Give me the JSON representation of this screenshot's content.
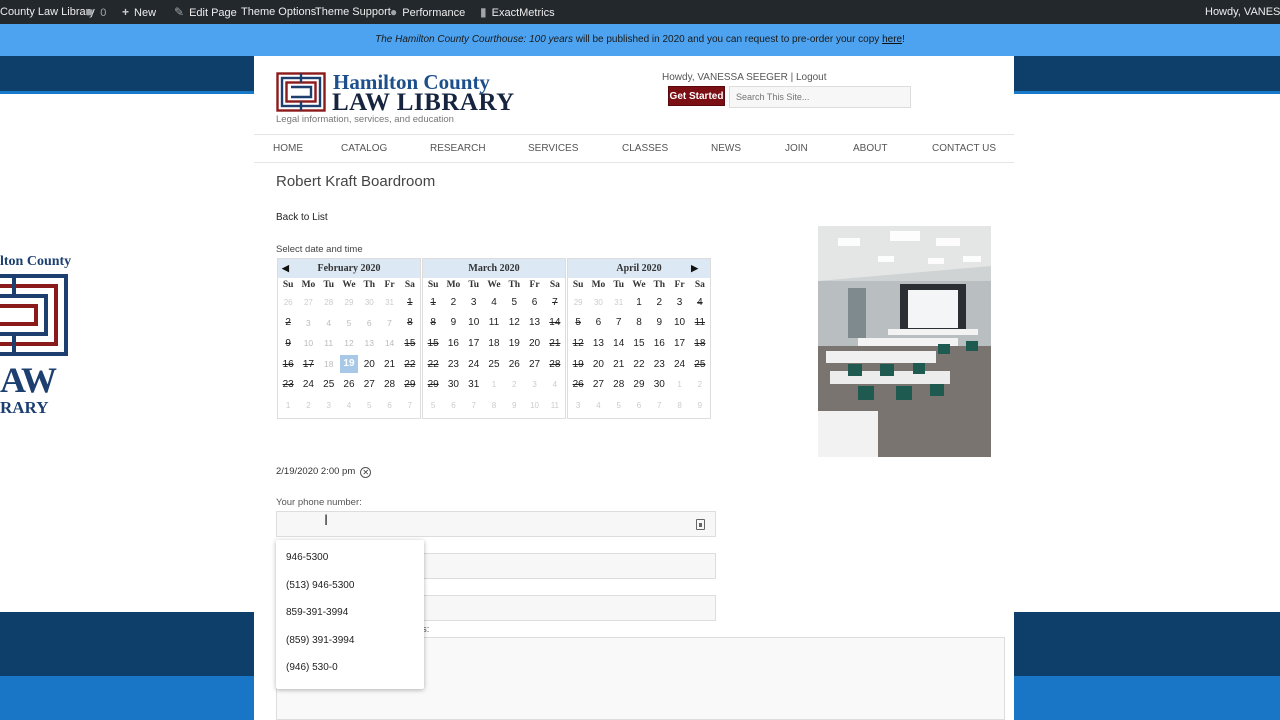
{
  "adminbar": {
    "site": "County Law Library",
    "comments_count": "0",
    "new": "New",
    "edit_page": "Edit Page",
    "theme_options": "Theme Options",
    "theme_support": "Theme Support",
    "performance": "Performance",
    "exactmetrics": "ExactMetrics",
    "howdy": "Howdy, VANESSA"
  },
  "announce": {
    "italic": "The Hamilton County Courthouse: 100 years",
    "text": " will be published in 2020 and you can request to pre-order your copy ",
    "link": "here",
    "tail": "!"
  },
  "bg_logo": {
    "line1": "lton County",
    "line2": "AW",
    "line3": "RARY"
  },
  "header": {
    "logo_name1": "Hamilton County",
    "logo_name2": "LAW LIBRARY",
    "logo_tagline": "Legal information, services, and education",
    "howdy": "Howdy, VANESSA SEEGER | Logout",
    "get_started": "Get Started",
    "search_placeholder": "Search This Site..."
  },
  "nav": [
    "HOME",
    "CATALOG",
    "RESEARCH",
    "SERVICES",
    "CLASSES",
    "NEWS",
    "JOIN",
    "ABOUT",
    "CONTACT US"
  ],
  "main": {
    "title": "Robert Kraft Boardroom",
    "back": "Back to List",
    "select_label": "Select date and time",
    "chosen_datetime": "2/19/2020 2:00 pm",
    "phone_label": "Your phone number:",
    "field4_label_fragment": "s:"
  },
  "calendar": {
    "weekdays": [
      "Su",
      "Mo",
      "Tu",
      "We",
      "Th",
      "Fr",
      "Sa"
    ],
    "prev_icon": "triangle-left-icon",
    "next_icon": "triangle-right-icon",
    "months": [
      {
        "title": "February 2020",
        "weeks": [
          [
            {
              "d": "26",
              "c": "other"
            },
            {
              "d": "27",
              "c": "other"
            },
            {
              "d": "28",
              "c": "other"
            },
            {
              "d": "29",
              "c": "other"
            },
            {
              "d": "30",
              "c": "other"
            },
            {
              "d": "31",
              "c": "other"
            },
            {
              "d": "1",
              "c": "strike"
            }
          ],
          [
            {
              "d": "2",
              "c": "strike"
            },
            {
              "d": "3",
              "c": "dim"
            },
            {
              "d": "4",
              "c": "dim"
            },
            {
              "d": "5",
              "c": "dim"
            },
            {
              "d": "6",
              "c": "dim"
            },
            {
              "d": "7",
              "c": "dim"
            },
            {
              "d": "8",
              "c": "strike"
            }
          ],
          [
            {
              "d": "9",
              "c": "strike"
            },
            {
              "d": "10",
              "c": "dim"
            },
            {
              "d": "11",
              "c": "dim"
            },
            {
              "d": "12",
              "c": "dim"
            },
            {
              "d": "13",
              "c": "dim"
            },
            {
              "d": "14",
              "c": "dim"
            },
            {
              "d": "15",
              "c": "strike"
            }
          ],
          [
            {
              "d": "16",
              "c": "strike"
            },
            {
              "d": "17",
              "c": "strike"
            },
            {
              "d": "18",
              "c": "dim"
            },
            {
              "d": "19",
              "c": "sel"
            },
            {
              "d": "20",
              "c": ""
            },
            {
              "d": "21",
              "c": ""
            },
            {
              "d": "22",
              "c": "strike"
            }
          ],
          [
            {
              "d": "23",
              "c": "strike"
            },
            {
              "d": "24",
              "c": ""
            },
            {
              "d": "25",
              "c": ""
            },
            {
              "d": "26",
              "c": ""
            },
            {
              "d": "27",
              "c": ""
            },
            {
              "d": "28",
              "c": ""
            },
            {
              "d": "29",
              "c": "strike"
            }
          ],
          [
            {
              "d": "1",
              "c": "other"
            },
            {
              "d": "2",
              "c": "other"
            },
            {
              "d": "3",
              "c": "other"
            },
            {
              "d": "4",
              "c": "other"
            },
            {
              "d": "5",
              "c": "other"
            },
            {
              "d": "6",
              "c": "other"
            },
            {
              "d": "7",
              "c": "other"
            }
          ]
        ]
      },
      {
        "title": "March 2020",
        "weeks": [
          [
            {
              "d": "1",
              "c": "strike"
            },
            {
              "d": "2",
              "c": ""
            },
            {
              "d": "3",
              "c": ""
            },
            {
              "d": "4",
              "c": ""
            },
            {
              "d": "5",
              "c": ""
            },
            {
              "d": "6",
              "c": ""
            },
            {
              "d": "7",
              "c": "strike"
            }
          ],
          [
            {
              "d": "8",
              "c": "strike"
            },
            {
              "d": "9",
              "c": ""
            },
            {
              "d": "10",
              "c": ""
            },
            {
              "d": "11",
              "c": ""
            },
            {
              "d": "12",
              "c": ""
            },
            {
              "d": "13",
              "c": ""
            },
            {
              "d": "14",
              "c": "strike"
            }
          ],
          [
            {
              "d": "15",
              "c": "strike"
            },
            {
              "d": "16",
              "c": ""
            },
            {
              "d": "17",
              "c": ""
            },
            {
              "d": "18",
              "c": ""
            },
            {
              "d": "19",
              "c": ""
            },
            {
              "d": "20",
              "c": ""
            },
            {
              "d": "21",
              "c": "strike"
            }
          ],
          [
            {
              "d": "22",
              "c": "strike"
            },
            {
              "d": "23",
              "c": ""
            },
            {
              "d": "24",
              "c": ""
            },
            {
              "d": "25",
              "c": ""
            },
            {
              "d": "26",
              "c": ""
            },
            {
              "d": "27",
              "c": ""
            },
            {
              "d": "28",
              "c": "strike"
            }
          ],
          [
            {
              "d": "29",
              "c": "strike"
            },
            {
              "d": "30",
              "c": ""
            },
            {
              "d": "31",
              "c": ""
            },
            {
              "d": "1",
              "c": "other"
            },
            {
              "d": "2",
              "c": "other"
            },
            {
              "d": "3",
              "c": "other"
            },
            {
              "d": "4",
              "c": "other"
            }
          ],
          [
            {
              "d": "5",
              "c": "other"
            },
            {
              "d": "6",
              "c": "other"
            },
            {
              "d": "7",
              "c": "other"
            },
            {
              "d": "8",
              "c": "other"
            },
            {
              "d": "9",
              "c": "other"
            },
            {
              "d": "10",
              "c": "other"
            },
            {
              "d": "11",
              "c": "other"
            }
          ]
        ]
      },
      {
        "title": "April 2020",
        "weeks": [
          [
            {
              "d": "29",
              "c": "other"
            },
            {
              "d": "30",
              "c": "other"
            },
            {
              "d": "31",
              "c": "other"
            },
            {
              "d": "1",
              "c": ""
            },
            {
              "d": "2",
              "c": ""
            },
            {
              "d": "3",
              "c": ""
            },
            {
              "d": "4",
              "c": "strike"
            }
          ],
          [
            {
              "d": "5",
              "c": "strike"
            },
            {
              "d": "6",
              "c": ""
            },
            {
              "d": "7",
              "c": ""
            },
            {
              "d": "8",
              "c": ""
            },
            {
              "d": "9",
              "c": ""
            },
            {
              "d": "10",
              "c": ""
            },
            {
              "d": "11",
              "c": "strike"
            }
          ],
          [
            {
              "d": "12",
              "c": "strike"
            },
            {
              "d": "13",
              "c": ""
            },
            {
              "d": "14",
              "c": ""
            },
            {
              "d": "15",
              "c": ""
            },
            {
              "d": "16",
              "c": ""
            },
            {
              "d": "17",
              "c": ""
            },
            {
              "d": "18",
              "c": "strike"
            }
          ],
          [
            {
              "d": "19",
              "c": "strike"
            },
            {
              "d": "20",
              "c": ""
            },
            {
              "d": "21",
              "c": ""
            },
            {
              "d": "22",
              "c": ""
            },
            {
              "d": "23",
              "c": ""
            },
            {
              "d": "24",
              "c": ""
            },
            {
              "d": "25",
              "c": "strike"
            }
          ],
          [
            {
              "d": "26",
              "c": "strike"
            },
            {
              "d": "27",
              "c": ""
            },
            {
              "d": "28",
              "c": ""
            },
            {
              "d": "29",
              "c": ""
            },
            {
              "d": "30",
              "c": ""
            },
            {
              "d": "1",
              "c": "other"
            },
            {
              "d": "2",
              "c": "other"
            }
          ],
          [
            {
              "d": "3",
              "c": "other"
            },
            {
              "d": "4",
              "c": "other"
            },
            {
              "d": "5",
              "c": "other"
            },
            {
              "d": "6",
              "c": "other"
            },
            {
              "d": "7",
              "c": "other"
            },
            {
              "d": "8",
              "c": "other"
            },
            {
              "d": "9",
              "c": "other"
            }
          ]
        ]
      }
    ]
  },
  "autocomplete": [
    "946-5300",
    "(513) 946-5300",
    "859-391-3994",
    "(859) 391-3994",
    "(946) 530-0"
  ],
  "colors": {
    "admin_bar": "#23282d",
    "announce": "#4da3f0",
    "brand_navy": "#0e3f6b",
    "get_started": "#7a1014",
    "selected_day": "#a8c8e8"
  }
}
